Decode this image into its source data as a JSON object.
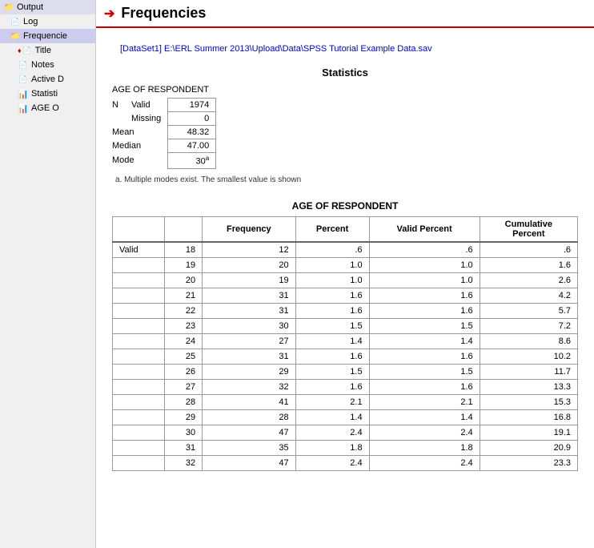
{
  "sidebar": {
    "items": [
      {
        "id": "output",
        "label": "Output",
        "indent": 0,
        "icon": "folder"
      },
      {
        "id": "log",
        "label": "Log",
        "indent": 1,
        "icon": "log"
      },
      {
        "id": "frequencies",
        "label": "Frequencie",
        "indent": 1,
        "icon": "folder",
        "selected": true
      },
      {
        "id": "title",
        "label": "Title",
        "indent": 2,
        "icon": "red"
      },
      {
        "id": "notes",
        "label": "Notes",
        "indent": 2,
        "icon": "blue"
      },
      {
        "id": "active",
        "label": "Active D",
        "indent": 2,
        "icon": "blue"
      },
      {
        "id": "statistics",
        "label": "Statisti",
        "indent": 2,
        "icon": "bar"
      },
      {
        "id": "age-output",
        "label": "AGE O",
        "indent": 2,
        "icon": "bar-red"
      }
    ]
  },
  "header": {
    "title": "Frequencies",
    "arrow": "➔"
  },
  "dataset": {
    "text": "[DataSet1] E:\\ERL Summer 2013\\Upload\\Data\\SPSS Tutorial Example Data.sav"
  },
  "statistics_section": {
    "title": "Statistics",
    "table_label": "AGE OF RESPONDENT",
    "rows": [
      {
        "group": "N",
        "label": "Valid",
        "value": "1974"
      },
      {
        "group": "",
        "label": "Missing",
        "value": "0"
      },
      {
        "group": "Mean",
        "label": "",
        "value": "48.32"
      },
      {
        "group": "Median",
        "label": "",
        "value": "47.00"
      },
      {
        "group": "Mode",
        "label": "",
        "value": "30ᵃ"
      }
    ],
    "footnote_a": "a. Multiple modes exist. The smallest value is shown"
  },
  "frequency_table": {
    "title": "AGE OF RESPONDENT",
    "headers": [
      "",
      "",
      "Frequency",
      "Percent",
      "Valid Percent",
      "Cumulative Percent"
    ],
    "rows": [
      {
        "group": "Valid",
        "age": "18",
        "freq": "12",
        "pct": ".6",
        "vpct": ".6",
        "cpct": ".6"
      },
      {
        "group": "",
        "age": "19",
        "freq": "20",
        "pct": "1.0",
        "vpct": "1.0",
        "cpct": "1.6"
      },
      {
        "group": "",
        "age": "20",
        "freq": "19",
        "pct": "1.0",
        "vpct": "1.0",
        "cpct": "2.6"
      },
      {
        "group": "",
        "age": "21",
        "freq": "31",
        "pct": "1.6",
        "vpct": "1.6",
        "cpct": "4.2"
      },
      {
        "group": "",
        "age": "22",
        "freq": "31",
        "pct": "1.6",
        "vpct": "1.6",
        "cpct": "5.7"
      },
      {
        "group": "",
        "age": "23",
        "freq": "30",
        "pct": "1.5",
        "vpct": "1.5",
        "cpct": "7.2"
      },
      {
        "group": "",
        "age": "24",
        "freq": "27",
        "pct": "1.4",
        "vpct": "1.4",
        "cpct": "8.6"
      },
      {
        "group": "",
        "age": "25",
        "freq": "31",
        "pct": "1.6",
        "vpct": "1.6",
        "cpct": "10.2"
      },
      {
        "group": "",
        "age": "26",
        "freq": "29",
        "pct": "1.5",
        "vpct": "1.5",
        "cpct": "11.7"
      },
      {
        "group": "",
        "age": "27",
        "freq": "32",
        "pct": "1.6",
        "vpct": "1.6",
        "cpct": "13.3"
      },
      {
        "group": "",
        "age": "28",
        "freq": "41",
        "pct": "2.1",
        "vpct": "2.1",
        "cpct": "15.3"
      },
      {
        "group": "",
        "age": "29",
        "freq": "28",
        "pct": "1.4",
        "vpct": "1.4",
        "cpct": "16.8"
      },
      {
        "group": "",
        "age": "30",
        "freq": "47",
        "pct": "2.4",
        "vpct": "2.4",
        "cpct": "19.1"
      },
      {
        "group": "",
        "age": "31",
        "freq": "35",
        "pct": "1.8",
        "vpct": "1.8",
        "cpct": "20.9"
      },
      {
        "group": "",
        "age": "32",
        "freq": "47",
        "pct": "2.4",
        "vpct": "2.4",
        "cpct": "23.3"
      }
    ]
  }
}
